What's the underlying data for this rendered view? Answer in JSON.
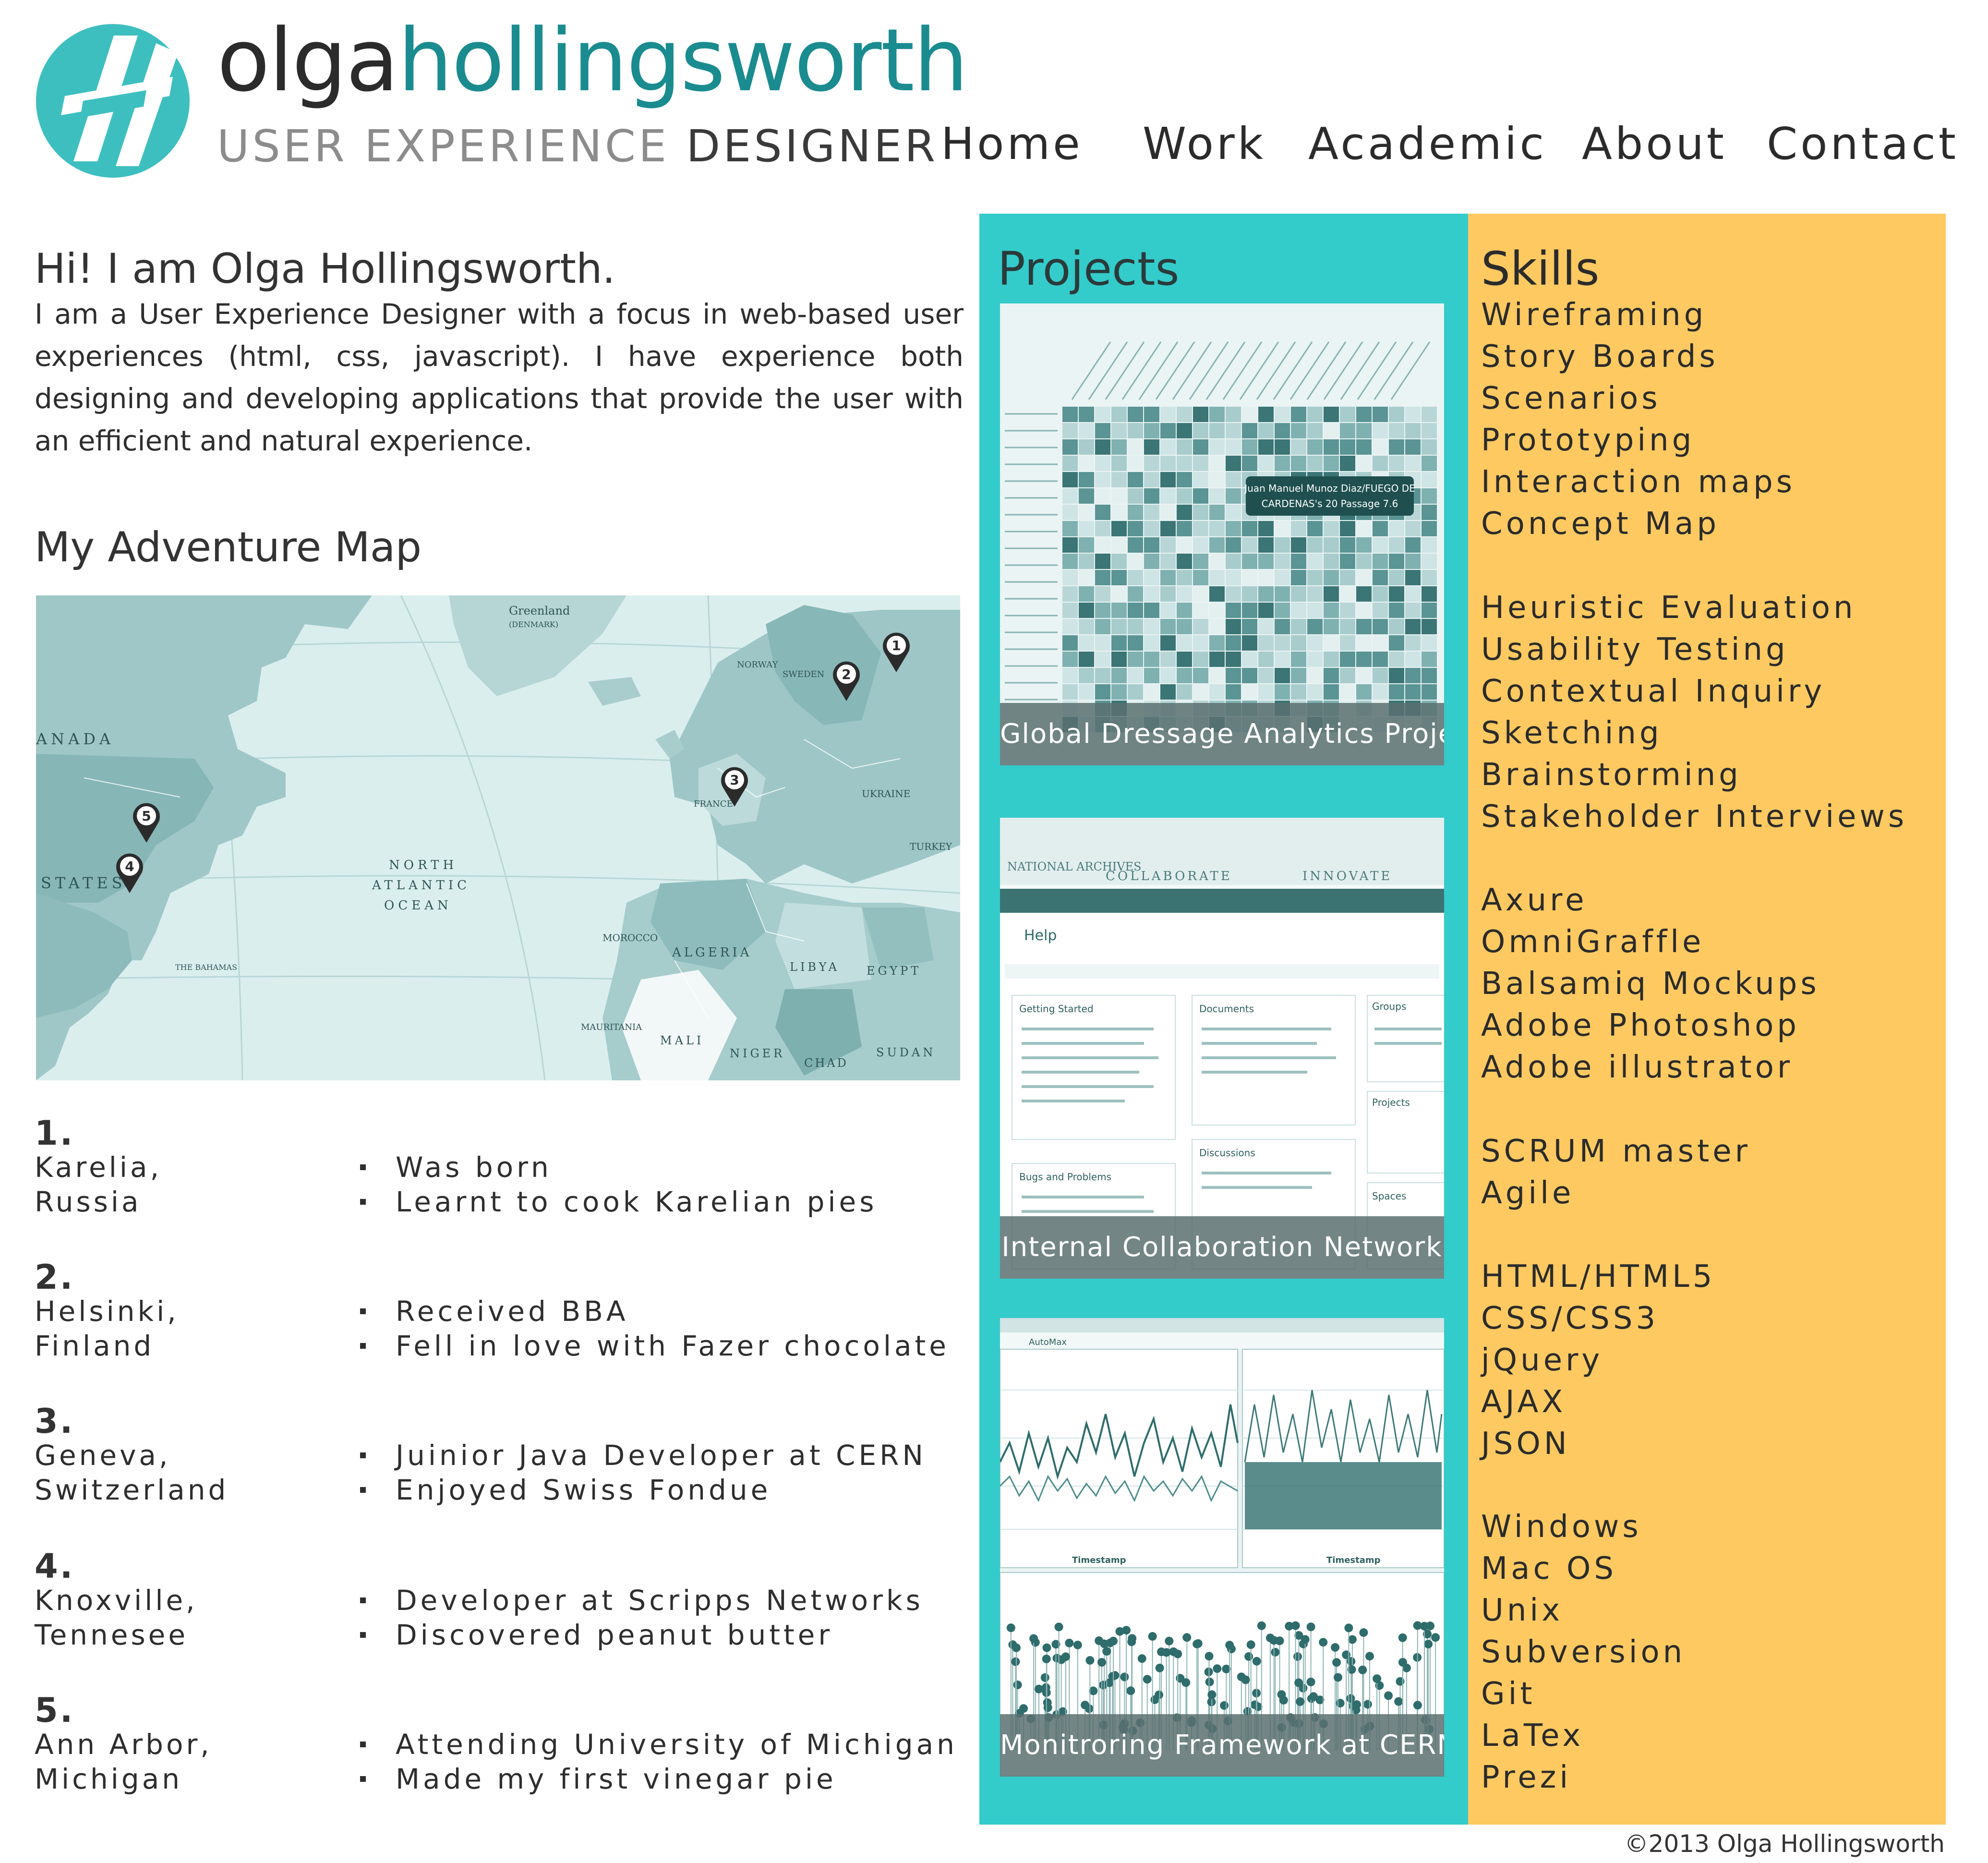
{
  "brand": {
    "first_name": "olga",
    "last_name": "hollingsworth",
    "tagline_light": "USER EXPERIENCE",
    "tagline_dark": "DESIGNER"
  },
  "nav": {
    "items": [
      {
        "label": "Home"
      },
      {
        "label": "Work"
      },
      {
        "label": "Academic"
      },
      {
        "label": "About"
      },
      {
        "label": "Contact"
      }
    ]
  },
  "intro": {
    "title": "Hi! I am Olga Hollingsworth.",
    "text": "I am a User Experience Designer with a focus in web-based user experiences (html, css, javascript). I have experience both designing and developing applications that provide the user with an efficient and natural experience."
  },
  "map": {
    "title": "My Adventure Map",
    "labels": {
      "greenland": "Greenland",
      "denmark": "(DENMARK)",
      "canada": "ANADA",
      "states": "STATES",
      "ocean1": "NORTH",
      "ocean2": "ATLANTIC",
      "ocean3": "OCEAN",
      "algeria": "ALGERIA",
      "libya": "LIBYA",
      "egypt": "EGYPT",
      "mali": "MALI",
      "niger": "NIGER",
      "chad": "CHAD",
      "sudan": "SUDAN",
      "morocco": "MOROCCO",
      "mauritania": "MAURITANIA",
      "france": "FRANCE",
      "norway": "NORWAY",
      "sweden": "SWEDEN",
      "ukraine": "UKRAINE",
      "turkey": "TURKEY",
      "bahamas": "THE BAHAMAS"
    },
    "pins": [
      "1",
      "2",
      "3",
      "4",
      "5"
    ]
  },
  "adventures": [
    {
      "number": "1.",
      "place_line1": "Karelia,",
      "place_line2": "Russia",
      "items": [
        "Was born",
        "Learnt to cook Karelian pies"
      ]
    },
    {
      "number": "2.",
      "place_line1": "Helsinki,",
      "place_line2": "Finland",
      "items": [
        "Received BBA",
        "Fell in love with Fazer chocolate"
      ]
    },
    {
      "number": "3.",
      "place_line1": "Geneva,",
      "place_line2": "Switzerland",
      "items": [
        "Juinior Java Developer at CERN",
        "Enjoyed Swiss Fondue"
      ]
    },
    {
      "number": "4.",
      "place_line1": "Knoxville,",
      "place_line2": "Tennesee",
      "items": [
        "Developer at Scripps Networks",
        "Discovered peanut butter"
      ]
    },
    {
      "number": "5.",
      "place_line1": "Ann Arbor,",
      "place_line2": "Michigan",
      "items": [
        "Attending University of Michigan",
        "Made my first vinegar pie"
      ]
    }
  ],
  "projects": {
    "title": "Projects",
    "items": [
      {
        "caption": "Global Dressage Analytics Project",
        "tooltip_line1": "Juan Manuel Munoz Diaz/FUEGO DE",
        "tooltip_line2": "CARDENAS's 20 Passage 7.6"
      },
      {
        "caption": "Internal Collaboration Network",
        "header_left": "NATIONAL ARCHIVES",
        "header_mid": "COLLABORATE",
        "header_right": "INNOVATE",
        "help": "Help",
        "section1": "Getting Started",
        "section2": "Documents",
        "section3": "Groups",
        "section4": "Bugs and Problems",
        "section5": "Discussions",
        "section6": "Spaces",
        "section7": "Projects"
      },
      {
        "caption": "Monitroring Framework at CERN",
        "axis_label": "Timestamp",
        "toolbar": "AutoMax"
      }
    ]
  },
  "skills": {
    "title": "Skills",
    "groups": [
      [
        "Wireframing",
        "Story Boards",
        "Scenarios",
        "Prototyping",
        "Interaction maps",
        "Concept Map"
      ],
      [
        "Heuristic Evaluation",
        "Usability Testing",
        "Contextual Inquiry",
        "Sketching",
        "Brainstorming",
        "Stakeholder Interviews"
      ],
      [
        "Axure",
        "OmniGraffle",
        "Balsamiq Mockups",
        "Adobe Photoshop",
        "Adobe illustrator"
      ],
      [
        "SCRUM master",
        "Agile"
      ],
      [
        "HTML/HTML5",
        "CSS/CSS3",
        "jQuery",
        "AJAX",
        "JSON"
      ],
      [
        "Windows",
        "Mac OS",
        "Unix",
        "Subversion",
        "Git",
        "LaTex",
        "Prezi"
      ]
    ]
  },
  "colors": {
    "teal_column": "#34cbcb",
    "skills_column": "#fdc960",
    "brand_teal": "#1a8c90",
    "logo_teal": "#3ebfbf"
  },
  "footer": {
    "copyright": "©2013 Olga Hollingsworth"
  }
}
